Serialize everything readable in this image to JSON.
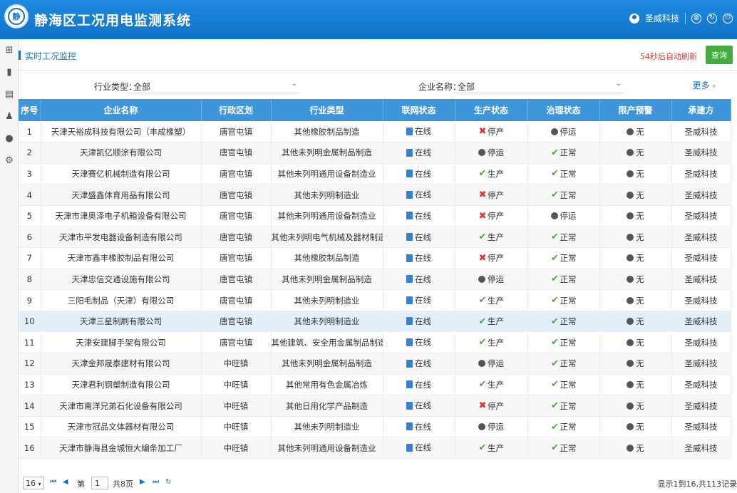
{
  "header": {
    "logo_text": "静",
    "title": "静海区工况用电监测系统",
    "user": "圣威科技"
  },
  "sidebar": {
    "items": [
      "sitemap-icon",
      "book-icon",
      "file-icon",
      "bell-icon",
      "info-icon",
      "gear-icon"
    ]
  },
  "crumb": {
    "title": "实时工况监控",
    "refresh": "54秒后自动刷新",
    "query_label": "查询"
  },
  "filters": {
    "industry_label": "行业类型：",
    "industry_value": "全部",
    "company_label": "企业名称：",
    "company_value": "全部",
    "more_label": "更多"
  },
  "table": {
    "columns": [
      "序号",
      "企业名称",
      "行政区划",
      "行业类型",
      "联网状态",
      "生产状态",
      "治理状态",
      "限产预警",
      "承建方"
    ],
    "rows": [
      {
        "no": "1",
        "name": "天津天裕成科技有限公司（丰成橡塑）",
        "district": "唐官屯镇",
        "industry": "其他橡胶制品制造",
        "net": "在线",
        "prod": "停产",
        "gov": "停运",
        "warn": "无",
        "builder": "圣威科技"
      },
      {
        "no": "2",
        "name": "天津凯亿顺涂有限公司",
        "district": "唐官屯镇",
        "industry": "其他未列明金属制品制造",
        "net": "在线",
        "prod": "停运",
        "gov": "正常",
        "warn": "无",
        "builder": "圣威科技"
      },
      {
        "no": "3",
        "name": "天津赛亿机械制造有限公司",
        "district": "唐官屯镇",
        "industry": "其他未列明通用设备制造业",
        "net": "在线",
        "prod": "生产",
        "gov": "正常",
        "warn": "无",
        "builder": "圣威科技"
      },
      {
        "no": "4",
        "name": "天津盛鑫体育用品有限公司",
        "district": "唐官屯镇",
        "industry": "其他未列明制造业",
        "net": "在线",
        "prod": "停产",
        "gov": "正常",
        "warn": "无",
        "builder": "圣威科技"
      },
      {
        "no": "5",
        "name": "天津市津奥泽电子机箱设备有限公司",
        "district": "唐官屯镇",
        "industry": "其他未列明通用设备制造业",
        "net": "在线",
        "prod": "停产",
        "gov": "停运",
        "warn": "无",
        "builder": "圣威科技"
      },
      {
        "no": "6",
        "name": "天津市平发电器设备制造有限公司",
        "district": "唐官屯镇",
        "industry": "其他未列明电气机械及器材制造",
        "net": "在线",
        "prod": "生产",
        "gov": "正常",
        "warn": "无",
        "builder": "圣威科技"
      },
      {
        "no": "7",
        "name": "天津市鑫丰橡胶制品有限公司",
        "district": "唐官屯镇",
        "industry": "其他橡胶制品制造",
        "net": "在线",
        "prod": "停产",
        "gov": "正常",
        "warn": "无",
        "builder": "圣威科技"
      },
      {
        "no": "8",
        "name": "天津忠信交通设施有限公司",
        "district": "唐官屯镇",
        "industry": "其他未列明金属制品制造",
        "net": "在线",
        "prod": "停运",
        "gov": "正常",
        "warn": "无",
        "builder": "圣威科技"
      },
      {
        "no": "9",
        "name": "三阳毛制品（天津）有限公司",
        "district": "唐官屯镇",
        "industry": "其他未列明制造业",
        "net": "在线",
        "prod": "生产",
        "gov": "正常",
        "warn": "无",
        "builder": "圣威科技"
      },
      {
        "no": "10",
        "name": "天津三星制刷有限公司",
        "district": "唐官屯镇",
        "industry": "其他未列明制造业",
        "net": "在线",
        "prod": "生产",
        "gov": "正常",
        "warn": "无",
        "builder": "圣威科技"
      },
      {
        "no": "11",
        "name": "天津安建脚手架有限公司",
        "district": "唐官屯镇",
        "industry": "其他建筑、安全用金属制品制造",
        "net": "在线",
        "prod": "生产",
        "gov": "正常",
        "warn": "无",
        "builder": "圣威科技"
      },
      {
        "no": "12",
        "name": "天津金邦晟泰建材有限公司",
        "district": "中旺镇",
        "industry": "其他未列明金属制品制造",
        "net": "在线",
        "prod": "停运",
        "gov": "正常",
        "warn": "无",
        "builder": "圣威科技"
      },
      {
        "no": "13",
        "name": "天津君利钢塑制造有限公司",
        "district": "中旺镇",
        "industry": "其他常用有色金属冶炼",
        "net": "在线",
        "prod": "生产",
        "gov": "正常",
        "warn": "无",
        "builder": "圣威科技"
      },
      {
        "no": "14",
        "name": "天津市南洋兄弟石化设备有限公司",
        "district": "中旺镇",
        "industry": "其他日用化学产品制造",
        "net": "在线",
        "prod": "停产",
        "gov": "正常",
        "warn": "无",
        "builder": "圣威科技"
      },
      {
        "no": "15",
        "name": "天津市冠品文体器材有限公司",
        "district": "中旺镇",
        "industry": "其他未列明制造业",
        "net": "在线",
        "prod": "停运",
        "gov": "正常",
        "warn": "无",
        "builder": "圣威科技"
      },
      {
        "no": "16",
        "name": "天津市静海县金城恒大编条加工厂",
        "district": "中旺镇",
        "industry": "其他未列明通用设备制造业",
        "net": "在线",
        "prod": "生产",
        "gov": "正常",
        "warn": "无",
        "builder": "圣威科技"
      }
    ]
  },
  "pager": {
    "page_size": "16",
    "page_prefix": "第",
    "page_value": "1",
    "total_pages": "共8页",
    "info": "显示1到16,共113记录"
  },
  "colors": {
    "header": "#1673c4",
    "th": "#3f95da",
    "query": "#43ad3f",
    "stop": "#e3342f",
    "ok": "#4aae3a"
  }
}
